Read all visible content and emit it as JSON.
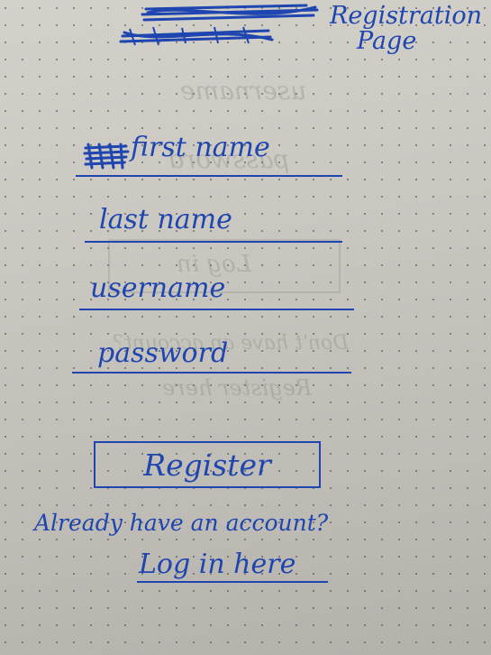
{
  "page": {
    "title_line1": "Registration",
    "title_line2": "Page"
  },
  "form": {
    "fields": [
      {
        "label": "first name"
      },
      {
        "label": "last name"
      },
      {
        "label": "username"
      },
      {
        "label": "password"
      }
    ],
    "register_label": "Register"
  },
  "footer": {
    "prompt": "Already have an account?",
    "login_link": "Log in here"
  },
  "colors": {
    "ink": "#1e45b0",
    "paper": "#c9c7c0"
  }
}
